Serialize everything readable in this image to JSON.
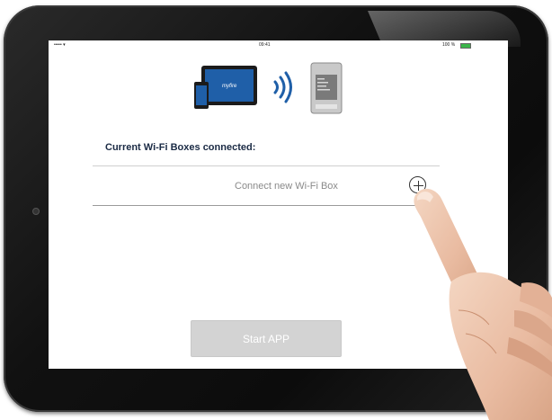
{
  "statusbar": {
    "signal": "••••• ▾",
    "time": "09:41",
    "battery": "100 %"
  },
  "hero": {
    "brand_text": "myfire"
  },
  "main": {
    "title": "Current Wi-Fi Boxes connected:",
    "connect_label": "Connect new Wi-Fi Box",
    "start_button_label": "Start APP"
  },
  "colors": {
    "title": "#1a2a44",
    "accent_blue": "#1f5fa8",
    "button_disabled": "#d3d3d3",
    "battery": "#3bb54a"
  },
  "icons": {
    "add": "plus-circle-icon",
    "wifi": "wifi-signal-icon"
  }
}
